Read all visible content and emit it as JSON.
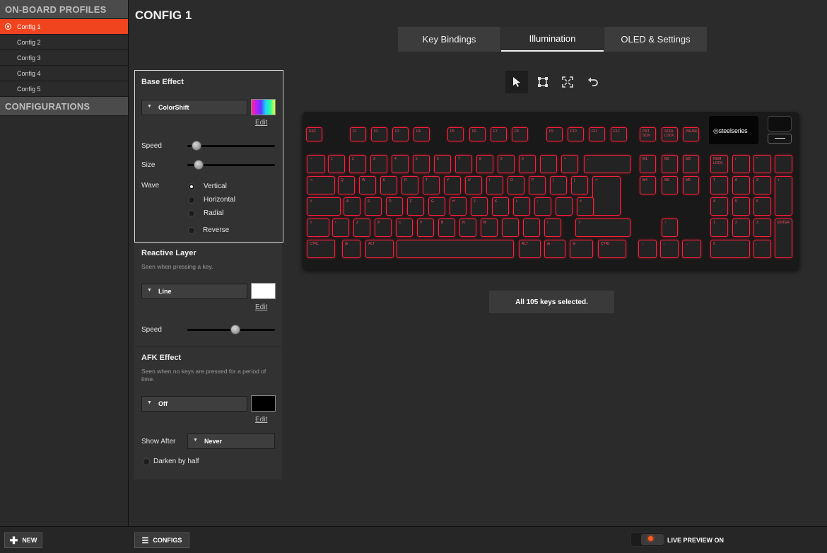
{
  "sidebar": {
    "profiles_header": "ON-BOARD PROFILES",
    "profiles": [
      {
        "label": "Config 1",
        "active": true
      },
      {
        "label": "Config 2",
        "active": false
      },
      {
        "label": "Config 3",
        "active": false
      },
      {
        "label": "Config 4",
        "active": false
      },
      {
        "label": "Config 5",
        "active": false
      }
    ],
    "configurations_header": "CONFIGURATIONS",
    "new_button": "NEW"
  },
  "page_title": "CONFIG 1",
  "tabs": [
    {
      "label": "Key Bindings",
      "active": false
    },
    {
      "label": "Illumination",
      "active": true
    },
    {
      "label": "OLED & Settings",
      "active": false
    }
  ],
  "base_effect": {
    "title": "Base Effect",
    "effect": "ColorShift",
    "edit": "Edit",
    "speed_label": "Speed",
    "speed_level": 0.05,
    "size_label": "Size",
    "size_level": 0.08,
    "wave_label": "Wave",
    "wave_options": [
      {
        "label": "Vertical",
        "selected": true
      },
      {
        "label": "Horizontal",
        "selected": false
      },
      {
        "label": "Radial",
        "selected": false
      }
    ],
    "reverse_label": "Reverse",
    "reverse_checked": false
  },
  "reactive_layer": {
    "title": "Reactive Layer",
    "subtitle": "Seen when pressing a key.",
    "effect": "Line",
    "color": "#ffffff",
    "edit": "Edit",
    "speed_label": "Speed",
    "speed_level": 0.55
  },
  "afk_effect": {
    "title": "AFK Effect",
    "subtitle": "Seen when no keys are pressed for a period of time.",
    "effect": "Off",
    "color": "#000000",
    "edit": "Edit",
    "show_after_label": "Show After",
    "show_after_value": "Never",
    "darken_label": "Darken by half",
    "darken_checked": false
  },
  "tools": [
    "select-icon",
    "box-select-icon",
    "select-all-icon",
    "undo-icon"
  ],
  "keyboard": {
    "brand": "steelseries",
    "key_color": "#ff1e3c",
    "rows": [
      [
        "ESC",
        "F1",
        "F2",
        "F3",
        "F4",
        "F5",
        "F6",
        "F7",
        "F8",
        "F9",
        "F10",
        "F11",
        "F12",
        "PRT SCN",
        "SCRL LOCK",
        "PAUSE"
      ],
      [
        "~",
        "1",
        "2",
        "3",
        "4",
        "5",
        "6",
        "7",
        "8",
        "9",
        "0",
        "-",
        "=",
        "←",
        "M1",
        "M2",
        "M3",
        "NUM LOCK",
        "/",
        "*",
        "-"
      ],
      [
        "⇥",
        "Q",
        "W",
        "E",
        "R",
        "T",
        "Y",
        "U",
        "I",
        "O",
        "P",
        "[",
        "]",
        "↵",
        "M4",
        "M5",
        "M6",
        "7",
        "8",
        "9",
        "+"
      ],
      [
        "⇪",
        "A",
        "S",
        "D",
        "F",
        "G",
        "H",
        "J",
        "K",
        "L",
        ";",
        "'",
        "#",
        "4",
        "5",
        "6"
      ],
      [
        "⇧",
        "\\",
        "Z",
        "X",
        "C",
        "V",
        "B",
        "N",
        "M",
        ",",
        ".",
        "/",
        "⇧",
        "↑",
        "1",
        "2",
        "3",
        "ENTER"
      ],
      [
        "CTRL",
        "⊞",
        "ALT",
        "",
        "ALT",
        "⊞",
        "⚙",
        "CTRL",
        "←",
        "↓",
        "→",
        "0",
        "."
      ]
    ]
  },
  "selection_status": "All 105 keys selected.",
  "bottom": {
    "configs_button": "CONFIGS",
    "live_preview": "LIVE PREVIEW ON"
  }
}
